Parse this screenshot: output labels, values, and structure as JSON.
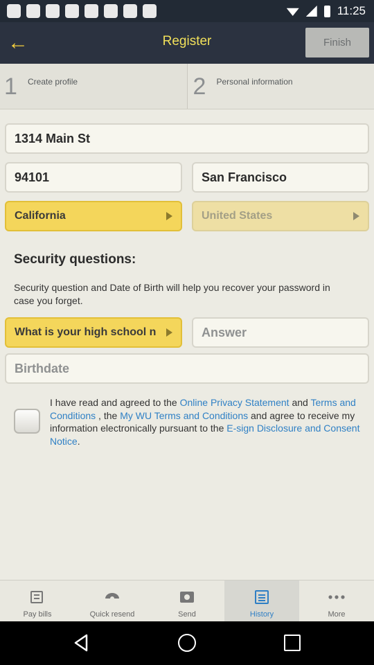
{
  "status_bar": {
    "time": "11:25",
    "left_icons": [
      "app-icon",
      "app-icon",
      "app-icon",
      "app-icon",
      "app-icon",
      "app-icon",
      "app-icon",
      "app-icon"
    ],
    "right_icons": [
      "wifi-icon",
      "signal-icon",
      "battery-icon"
    ]
  },
  "header": {
    "title": "Register",
    "finish_label": "Finish",
    "accent_color": "#f5cf3e"
  },
  "steps": [
    {
      "number": "1",
      "label": "Create profile"
    },
    {
      "number": "2",
      "label": "Personal information"
    }
  ],
  "form": {
    "street": "1314 Main St",
    "zip": "94101",
    "city": "San Francisco",
    "state": "California",
    "country_placeholder": "United States"
  },
  "security": {
    "title": "Security questions:",
    "description": "Security question and Date of Birth will help you recover your password in case you forget.",
    "question": "What is your high school n",
    "answer_placeholder": "Answer",
    "birthdate_placeholder": "Birthdate"
  },
  "agreement": {
    "text_1": "I have read and agreed to the ",
    "link_1": "Online Privacy Statement",
    "text_2": " and ",
    "link_2": "Terms and Conditions",
    "text_3": " , the ",
    "link_3": "My WU Terms and Conditions",
    "text_4": " and agree to receive my information electronically pursuant to the ",
    "link_4": "E-sign Disclosure and Consent Notice",
    "text_5": ".",
    "checked": false
  },
  "tabs": [
    {
      "label": "Pay bills",
      "icon": "bills-icon",
      "active": false
    },
    {
      "label": "Quick resend",
      "icon": "quick-resend-icon",
      "active": false
    },
    {
      "label": "Send",
      "icon": "send-icon",
      "active": false
    },
    {
      "label": "History",
      "icon": "history-icon",
      "active": true
    },
    {
      "label": "More",
      "icon": "more-icon",
      "active": false
    }
  ],
  "colors": {
    "header_bg": "#2b3240",
    "select_active": "#f4d65b",
    "link": "#2f80c5",
    "tab_active": "#2f7fc5"
  }
}
